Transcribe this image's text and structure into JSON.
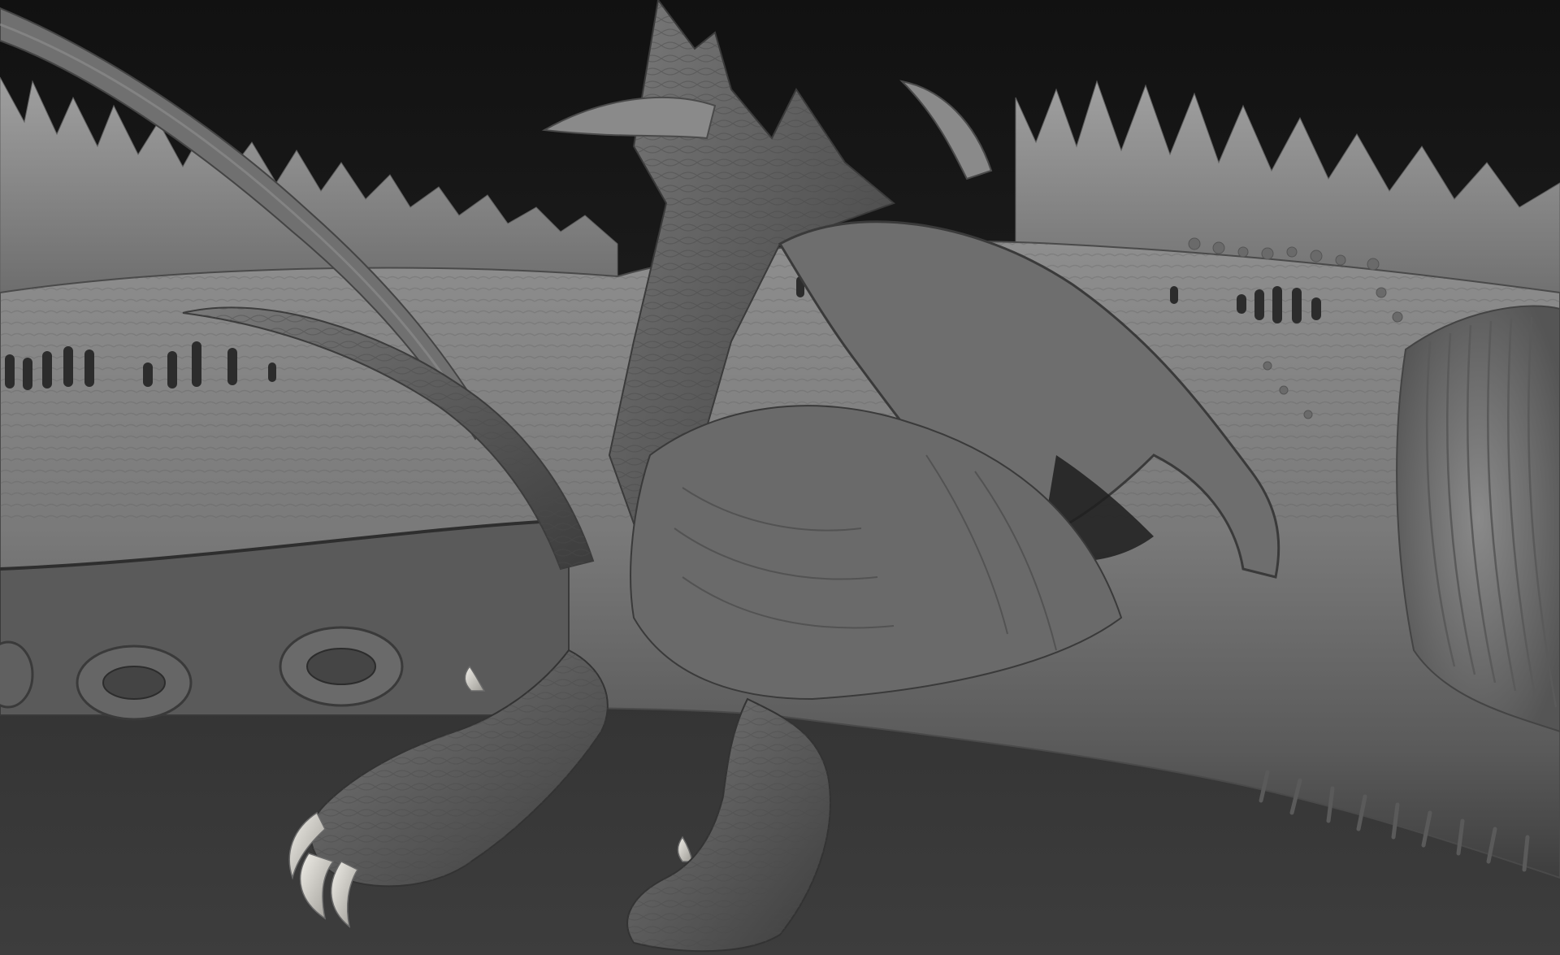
{
  "scene": {
    "subject": "creature-sculpt",
    "colors": {
      "background_top": "#121212",
      "background_bottom": "#3c3c3c",
      "clay_light": "#9a9a9a",
      "clay_mid": "#707070",
      "clay_dark": "#3a3a3a",
      "claw": "#d8d6d0"
    }
  }
}
